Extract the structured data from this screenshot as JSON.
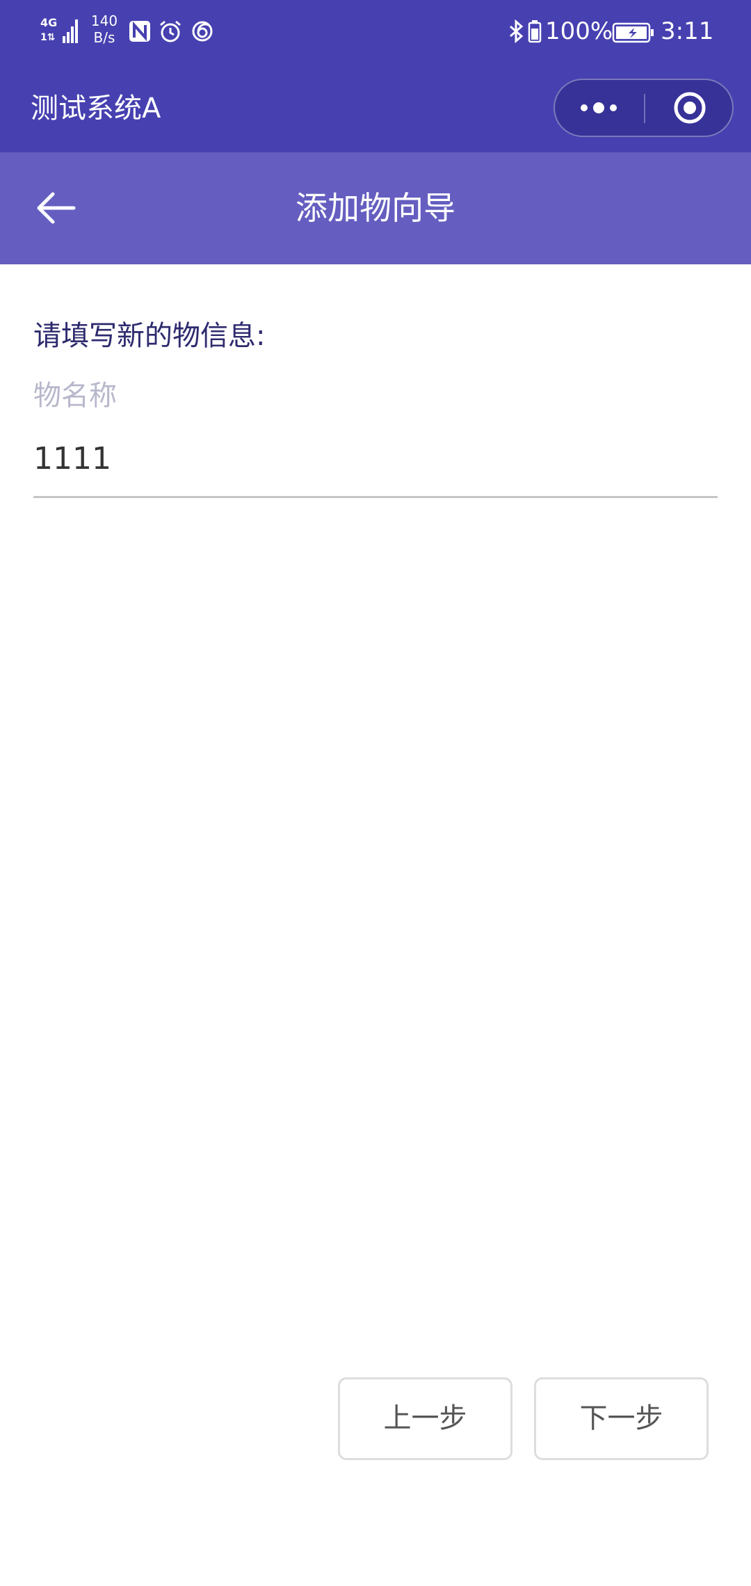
{
  "status_bar": {
    "network_type": "4G",
    "network_sub": "1⇅",
    "speed_value": "140",
    "speed_unit": "B/s",
    "battery_percent": "100%",
    "time": "3:11",
    "icons": [
      "signal-icon",
      "nfc-icon",
      "alarm-icon",
      "swirl-icon",
      "bluetooth-icon",
      "battery-small-icon",
      "battery-charging-icon"
    ]
  },
  "app_bar": {
    "title": "测试系统A",
    "capsule": {
      "more_icon": "more-dots-icon",
      "close_icon": "target-circle-icon"
    }
  },
  "header": {
    "title": "添加物向导",
    "back_icon": "back-arrow-icon"
  },
  "form": {
    "prompt": "请填写新的物信息:",
    "field_label": "物名称",
    "field_value": "1111"
  },
  "buttons": {
    "prev": "上一步",
    "next": "下一步"
  },
  "colors": {
    "status_bar_bg": "#4640b0",
    "header_bg": "#655ec0",
    "prompt_text": "#2d2a6e",
    "label_text": "#b8b8cc"
  }
}
